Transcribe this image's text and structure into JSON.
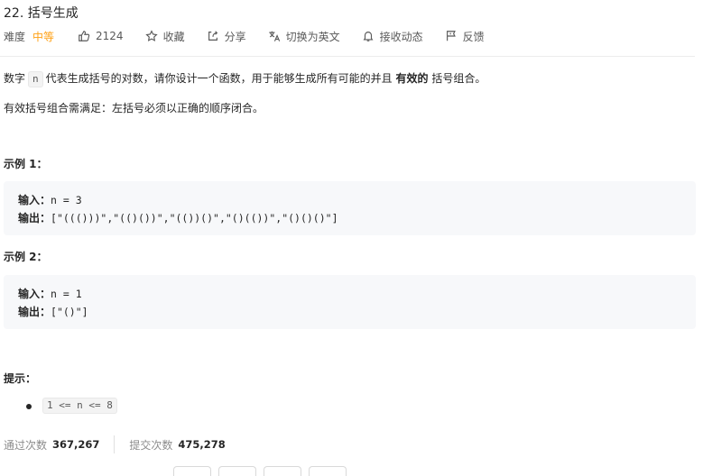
{
  "problem": {
    "title": "22. 括号生成"
  },
  "toolbar": {
    "difficulty_label": "难度",
    "difficulty_value": "中等",
    "likes": "2124",
    "favorite": "收藏",
    "share": "分享",
    "switch_lang": "切换为英文",
    "subscribe": "接收动态",
    "feedback": "反馈"
  },
  "description": {
    "p1_before": "数字",
    "p1_code": "n",
    "p1_middle": "代表生成括号的对数，请你设计一个函数，用于能够生成所有可能的并且",
    "p1_strong": "有效的",
    "p1_after": "括号组合。",
    "p2": "有效括号组合需满足：左括号必须以正确的顺序闭合。"
  },
  "examples": [
    {
      "heading": "示例 1：",
      "input_label": "输入：",
      "input_value": "n = 3",
      "output_label": "输出：",
      "output_value": "[\"((()))\",\"(()())\",\"(())()\",\"()(())\",\"()()()\"]"
    },
    {
      "heading": "示例 2：",
      "input_label": "输入：",
      "input_value": "n = 1",
      "output_label": "输出：",
      "output_value": "[\"()\"]"
    }
  ],
  "hints": {
    "heading": "提示：",
    "items": [
      "1 <= n <= 8"
    ]
  },
  "stats": {
    "accepted_label": "通过次数",
    "accepted_value": "367,267",
    "submitted_label": "提交次数",
    "submitted_value": "475,278"
  },
  "colors": {
    "difficulty_medium": "#ffa116",
    "text": "#262626",
    "muted": "#595959",
    "code_bg": "#f7f8fa"
  },
  "icons": {
    "like": "thumbs-up-icon",
    "favorite": "star-icon",
    "share": "share-icon",
    "switch_lang": "translate-icon",
    "subscribe": "bell-icon",
    "feedback": "flag-icon"
  }
}
